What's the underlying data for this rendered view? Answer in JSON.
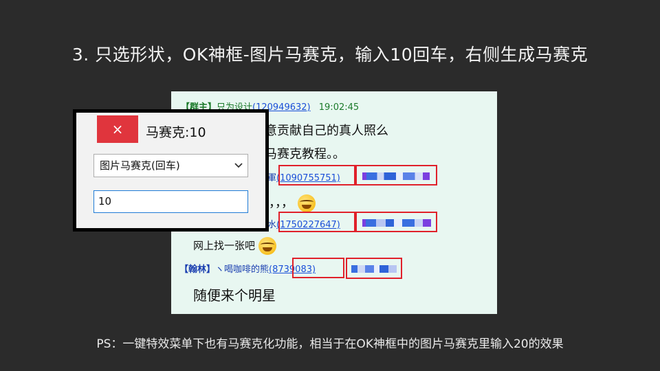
{
  "slide": {
    "title": "3. 只选形状，OK神框-图片马赛克，输入10回车，右侧生成马赛克",
    "footnote": "PS：一键特效菜单下也有马赛克化功能，相当于在OK神框中的图片马赛克里输入20的效果"
  },
  "chat": {
    "header": {
      "tag": "【群主】",
      "name": "只为设计",
      "qq": "(120949632)",
      "time": "19:02:45"
    },
    "line1": "意贡献自己的真人照么",
    "line2": "马赛克教程。。",
    "sender2": {
      "name_tail": "軍",
      "qq": "(1090755751)"
    },
    "line3": "，，，",
    "sender3": {
      "name_tail": "水",
      "qq": "(1750227647)"
    },
    "line4": "网上找一张吧",
    "sender4": {
      "tag": "【翰林】",
      "name": "ヽ喝咖啡的熊",
      "qq": "(8739083)"
    },
    "line5": "随便来个明星"
  },
  "dialog": {
    "close_glyph": "×",
    "title": "马赛克:10",
    "select_value": "图片马赛克(回车)",
    "input_value": "10"
  },
  "colors": {
    "background": "#2b2b2b",
    "chat_bg": "#e8f7f1",
    "highlight_red": "#e0202a",
    "close_red": "#e0353d"
  }
}
